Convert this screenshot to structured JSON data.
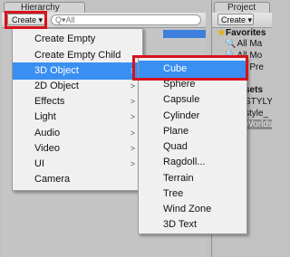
{
  "hierarchy": {
    "tab_title": "Hierarchy",
    "create_label": "Create ▾",
    "search_placeholder": "Q▾All"
  },
  "project": {
    "tab_title": "Project",
    "create_label": "Create ▾",
    "favorites_label": "Favorites",
    "favorites": [
      "All Ma",
      "All Mo",
      "All Pre"
    ],
    "assets_label": "sets",
    "assets": [
      "STYLY",
      "style_",
      "Worlds"
    ]
  },
  "menu": {
    "items": [
      {
        "label": "Create Empty",
        "has_submenu": false
      },
      {
        "label": "Create Empty Child",
        "has_submenu": false
      },
      {
        "label": "3D Object",
        "has_submenu": true,
        "selected": true
      },
      {
        "label": "2D Object",
        "has_submenu": true
      },
      {
        "label": "Effects",
        "has_submenu": true
      },
      {
        "label": "Light",
        "has_submenu": true
      },
      {
        "label": "Audio",
        "has_submenu": true
      },
      {
        "label": "Video",
        "has_submenu": true
      },
      {
        "label": "UI",
        "has_submenu": true
      },
      {
        "label": "Camera",
        "has_submenu": false
      }
    ],
    "arrow": ">"
  },
  "submenu": {
    "items": [
      {
        "label": "Cube",
        "selected": true
      },
      {
        "label": "Sphere"
      },
      {
        "label": "Capsule"
      },
      {
        "label": "Cylinder"
      },
      {
        "label": "Plane"
      },
      {
        "label": "Quad"
      },
      {
        "label": "Ragdoll..."
      },
      {
        "label": "Terrain"
      },
      {
        "label": "Tree"
      },
      {
        "label": "Wind Zone"
      },
      {
        "label": "3D Text"
      }
    ]
  },
  "colors": {
    "highlight_red": "#d8121c",
    "selection_blue": "#3a8ff2"
  }
}
